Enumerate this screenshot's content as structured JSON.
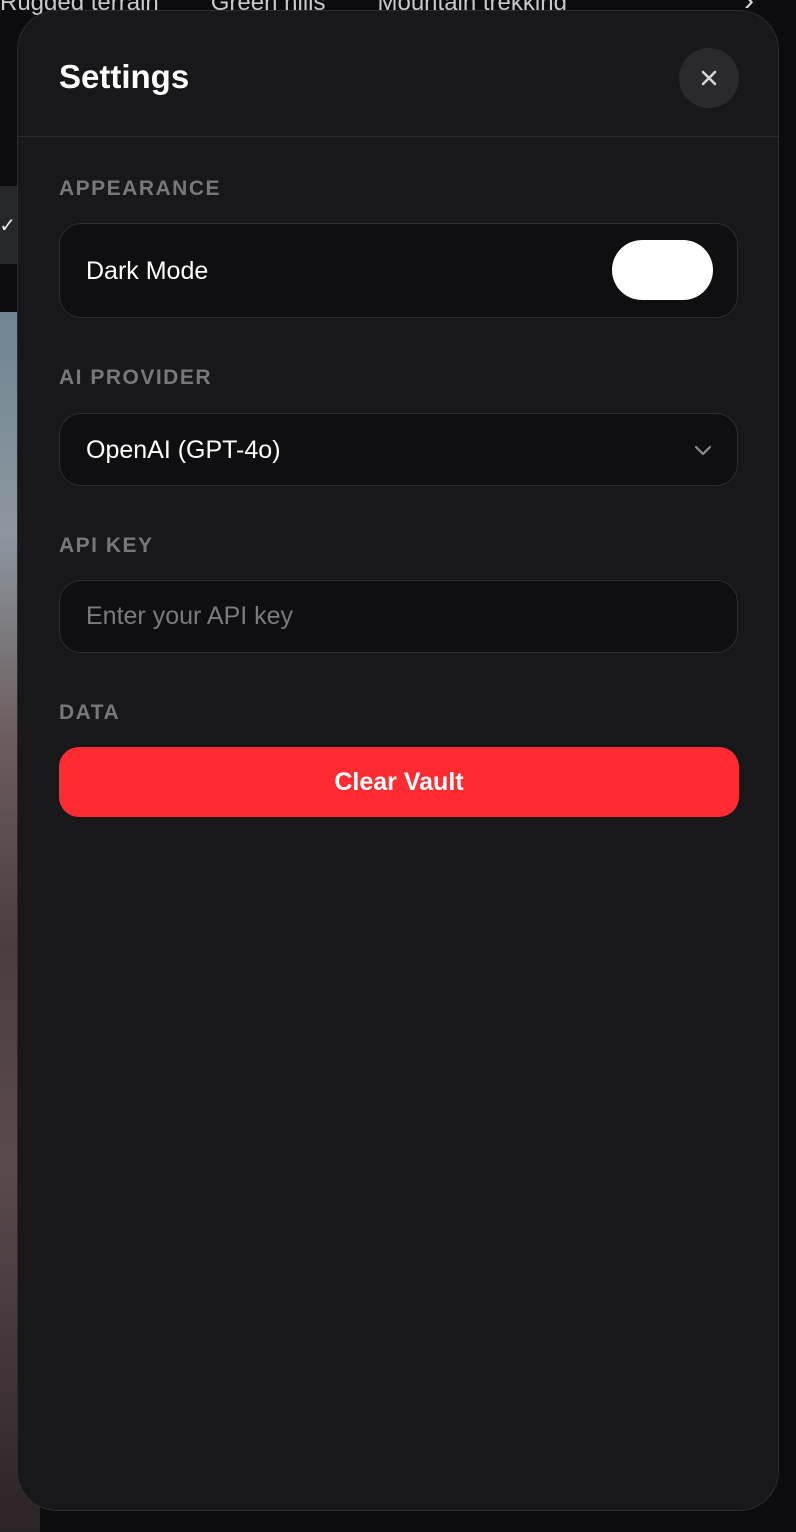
{
  "background": {
    "chips": [
      "Rugged terrain",
      "Green hills",
      "Mountain trekking"
    ],
    "next_icon": "chevron-right-icon",
    "check_icon": "check-icon"
  },
  "modal": {
    "title": "Settings",
    "close_icon": "close-icon"
  },
  "appearance": {
    "label": "APPEARANCE",
    "dark_mode_label": "Dark Mode",
    "dark_mode_enabled": true
  },
  "ai_provider": {
    "label": "AI PROVIDER",
    "selected": "OpenAI (GPT-4o)",
    "chevron_icon": "chevron-down-icon"
  },
  "api_key": {
    "label": "API KEY",
    "value": "",
    "placeholder": "Enter your API key"
  },
  "data_section": {
    "label": "DATA",
    "clear_button": "Clear Vault"
  },
  "colors": {
    "modal_bg": "#18181b",
    "field_bg": "#0f0f11",
    "danger": "#fe2c30",
    "section_label": "#77777c"
  }
}
